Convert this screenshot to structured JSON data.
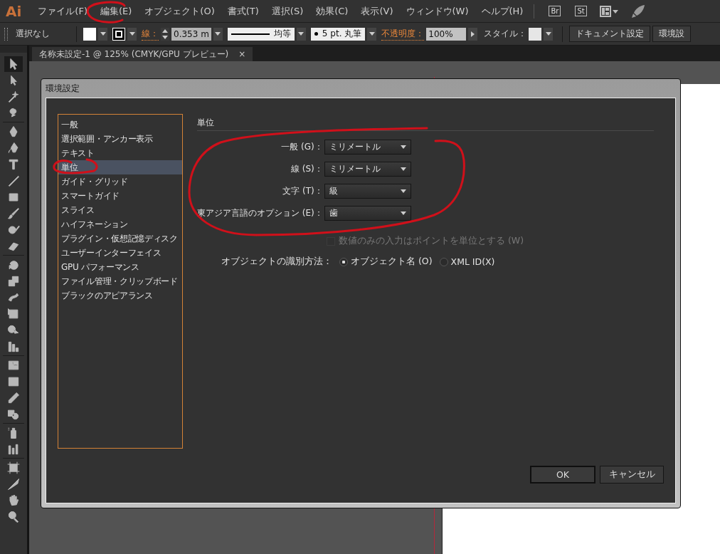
{
  "app_logo": "Ai",
  "menu": [
    "ファイル(F)",
    "編集(E)",
    "オブジェクト(O)",
    "書式(T)",
    "選択(S)",
    "効果(C)",
    "表示(V)",
    "ウィンドウ(W)",
    "ヘルプ(H)"
  ],
  "app_switchers": [
    "Br",
    "St"
  ],
  "control_bar": {
    "selection": "選択なし",
    "stroke_label": "線：",
    "stroke_weight": "0.353 m",
    "stroke_profile": "均等",
    "brush": "5 pt. 丸筆",
    "opacity_label": "不透明度：",
    "opacity": "100%",
    "style_label": "スタイル：",
    "buttons": [
      "ドキュメント設定",
      "環境設"
    ]
  },
  "document_tab": {
    "title": "名称未設定-1 @ 125% (CMYK/GPU プレビュー)",
    "close": "×"
  },
  "tools": [
    {
      "selected": true
    },
    {
      "selected": false
    },
    {
      "selected": false
    },
    {
      "selected": false
    },
    {
      "selected": false
    },
    {
      "selected": false
    },
    {
      "selected": false
    },
    {
      "selected": false
    },
    {
      "selected": false
    },
    {
      "selected": false
    },
    {
      "selected": false
    },
    {
      "selected": false
    },
    {
      "selected": false
    },
    {
      "selected": false
    },
    {
      "selected": false
    },
    {
      "selected": false
    },
    {
      "selected": false
    },
    {
      "selected": false
    },
    {
      "selected": false
    },
    {
      "selected": false
    },
    {
      "selected": false
    },
    {
      "selected": false
    },
    {
      "selected": false
    },
    {
      "selected": false
    },
    {
      "selected": false
    },
    {
      "selected": false
    },
    {
      "selected": false
    },
    {
      "selected": false
    }
  ],
  "dialog": {
    "title": "環境設定",
    "categories": [
      {
        "label": "一般",
        "selected": false
      },
      {
        "label": "選択範囲・アンカー表示",
        "selected": false
      },
      {
        "label": "テキスト",
        "selected": false
      },
      {
        "label": "単位",
        "selected": true
      },
      {
        "label": "ガイド・グリッド",
        "selected": false
      },
      {
        "label": "スマートガイド",
        "selected": false
      },
      {
        "label": "スライス",
        "selected": false
      },
      {
        "label": "ハイフネーション",
        "selected": false
      },
      {
        "label": "プラグイン・仮想記憶ディスク",
        "selected": false
      },
      {
        "label": "ユーザーインターフェイス",
        "selected": false
      },
      {
        "label": "GPU パフォーマンス",
        "selected": false
      },
      {
        "label": "ファイル管理・クリップボード",
        "selected": false
      },
      {
        "label": "ブラックのアピアランス",
        "selected": false
      }
    ],
    "section_title": "単位",
    "unit_fields": [
      {
        "label": "一般 (G)：",
        "value": "ミリメートル"
      },
      {
        "label": "線 (S)：",
        "value": "ミリメートル"
      },
      {
        "label": "文字 (T)：",
        "value": "級"
      },
      {
        "label": "東アジア言語のオプション (E)：",
        "value": "歯"
      }
    ],
    "points_only_checkbox": {
      "label": "数値のみの入力はポイントを単位とする (W)",
      "checked": false,
      "disabled": true
    },
    "identify_label": "オブジェクトの識別方法：",
    "identify_options": [
      {
        "label": "オブジェクト名 (O)",
        "selected": true
      },
      {
        "label": "XML ID(X)",
        "selected": false
      }
    ],
    "buttons": [
      {
        "label": "OK",
        "kind": "default"
      },
      {
        "label": "キャンセル",
        "kind": "normal"
      }
    ]
  }
}
